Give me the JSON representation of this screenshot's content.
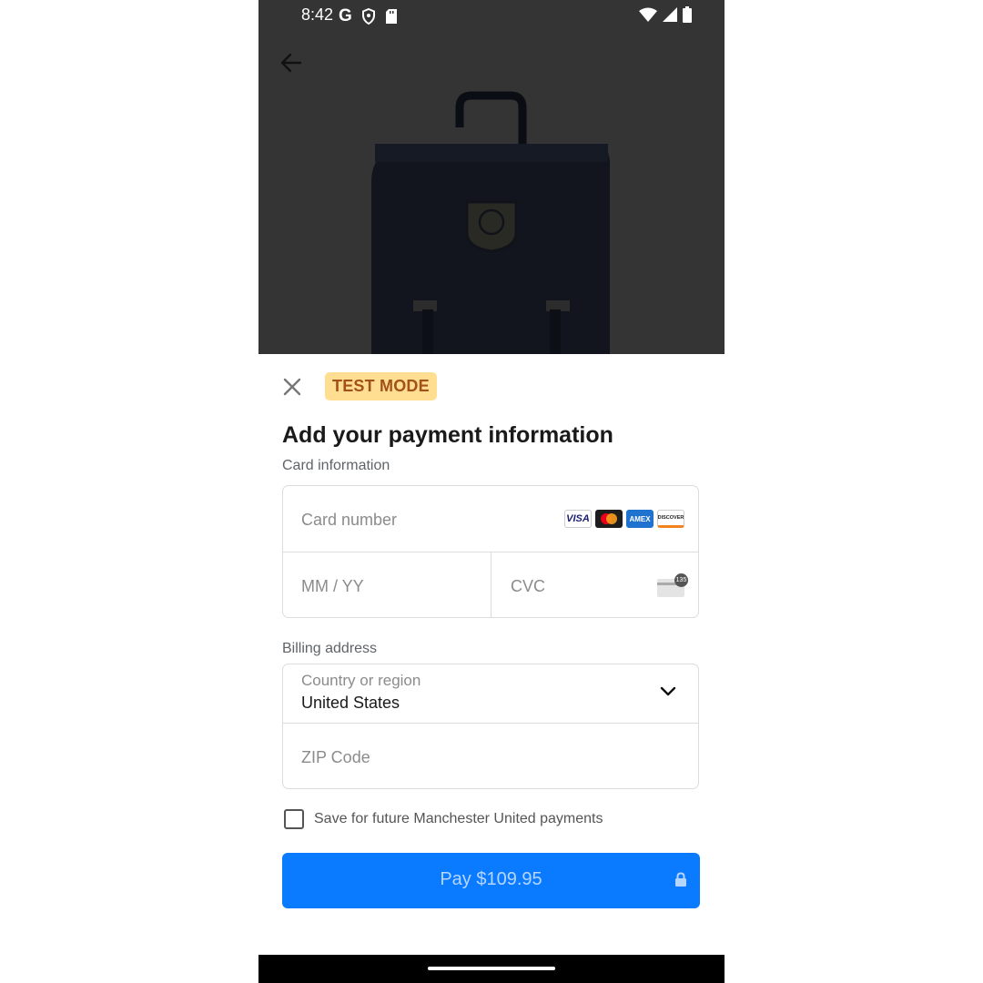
{
  "status_bar": {
    "time": "8:42",
    "g_glyph": "G"
  },
  "sheet": {
    "badge": "TEST MODE",
    "title": "Add your payment information",
    "card_section_label": "Card information",
    "card_number_placeholder": "Card number",
    "expiry_placeholder": "MM / YY",
    "cvc_placeholder": "CVC",
    "cvc_hint_digits": "135",
    "brands": [
      "VISA",
      "AMEX",
      "DISCOVER"
    ],
    "billing_section_label": "Billing address",
    "country_label": "Country or region",
    "country_value": "United States",
    "zip_placeholder": "ZIP Code",
    "save_label": "Save for future Manchester United payments",
    "pay_label": "Pay $109.95"
  },
  "colors": {
    "accent": "#0a7aff",
    "badge_bg": "#ffde92",
    "badge_text": "#a2511b",
    "overlay": "#343434"
  },
  "icons": [
    "back-arrow-icon",
    "close-icon",
    "chevron-down-icon",
    "lock-icon",
    "wifi-icon",
    "signal-icon",
    "battery-icon"
  ]
}
